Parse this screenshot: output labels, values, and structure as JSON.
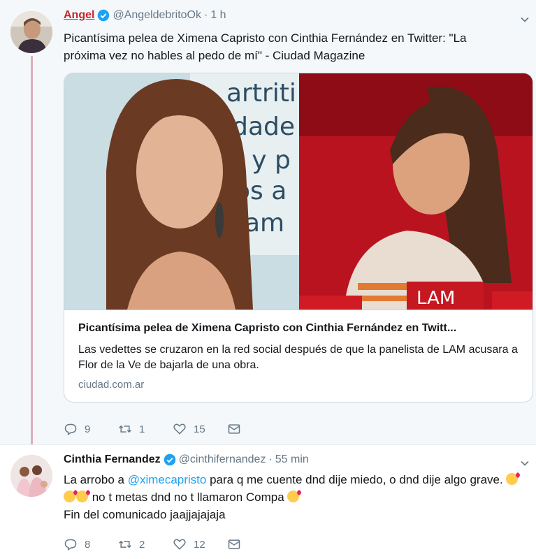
{
  "tweets": [
    {
      "name": "Angel",
      "handle": "@AngeldebritoOk",
      "separator": "·",
      "time": "1 h",
      "text": "Picantísima pelea de Ximena Capristo con Cinthia Fernández en Twitter: \"La próxima vez no hables al pedo de mí\" - Ciudad Magazine",
      "card": {
        "title": "Picantísima pelea de Ximena Capristo con Cinthia Fernández en Twitt...",
        "description": "Las vedettes se cruzaron en la red social después de que la panelista de LAM acusara a Flor de la Ve de bajarla de una obra.",
        "domain": "ciudad.com.ar",
        "image_text_left": [
          "artriti",
          "edade",
          "s y p",
          "os a",
          "am"
        ],
        "image_text_right": "LAM"
      },
      "replies": "9",
      "retweets": "1",
      "likes": "15"
    },
    {
      "name": "Cinthia Fernandez",
      "handle": "@cinthifernandez",
      "separator": "·",
      "time": "55 min",
      "text_part1": "La  arrobo a ",
      "mention": "@ximecapristo",
      "text_part2": " para q me cuente dnd dije miedo, o dnd dije algo grave. ",
      "text_part3": " no t metas dnd no t llamaron Compa ",
      "text_part4": "Fin del comunicado jaajjajajaja",
      "replies": "8",
      "retweets": "2",
      "likes": "12"
    }
  ],
  "icons": {
    "reply": "reply-icon",
    "retweet": "retweet-icon",
    "like": "heart-icon",
    "dm": "envelope-icon",
    "verified": "verified-badge-icon",
    "caret": "chevron-down-icon"
  },
  "colors": {
    "link_blue": "#1da1f2",
    "thread_line": "#e0aeba",
    "name_red": "#c2272d",
    "muted": "#657786"
  }
}
